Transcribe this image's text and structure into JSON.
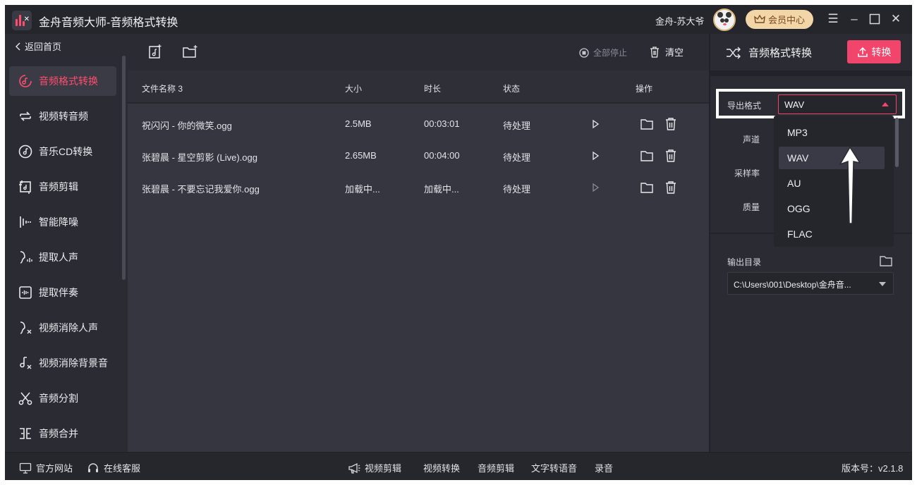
{
  "app": {
    "title": "金舟音频大师-音频格式转换",
    "user_name": "金舟-苏大爷",
    "vip_label": "会员中心"
  },
  "sidebar": {
    "back_label": "返回首页",
    "items": [
      {
        "label": "音频格式转换",
        "icon": "format-convert-icon",
        "active": true
      },
      {
        "label": "视频转音频",
        "icon": "video-to-audio-icon"
      },
      {
        "label": "音乐CD转换",
        "icon": "cd-icon"
      },
      {
        "label": "音频剪辑",
        "icon": "audio-cut-icon"
      },
      {
        "label": "智能降噪",
        "icon": "denoise-icon"
      },
      {
        "label": "提取人声",
        "icon": "voice-extract-icon"
      },
      {
        "label": "提取伴奏",
        "icon": "accompaniment-icon"
      },
      {
        "label": "视频消除人声",
        "icon": "video-remove-voice-icon"
      },
      {
        "label": "视频消除背景音",
        "icon": "video-remove-bgm-icon"
      },
      {
        "label": "音频分割",
        "icon": "scissors-icon"
      },
      {
        "label": "音频合并",
        "icon": "merge-icon"
      }
    ]
  },
  "toolbar": {
    "stop_all_label": "全部停止",
    "clear_label": "清空"
  },
  "list": {
    "headers": {
      "name": "文件名称 3",
      "size": "大小",
      "duration": "时长",
      "status": "状态",
      "actions": "操作"
    },
    "rows": [
      {
        "name": "祝闪闪 - 你的微笑.ogg",
        "size": "2.5MB",
        "duration": "00:03:01",
        "status": "待处理"
      },
      {
        "name": "张碧晨 - 星空剪影 (Live).ogg",
        "size": "2.65MB",
        "duration": "00:04:00",
        "status": "待处理"
      },
      {
        "name": "张碧晨 - 不要忘记我爱你.ogg",
        "size": "加载中...",
        "duration": "加载中...",
        "status": "待处理"
      }
    ]
  },
  "panel": {
    "title": "音频格式转换",
    "convert_label": "转换",
    "format_label": "导出格式",
    "format_value": "WAV",
    "channel_label": "声道",
    "sample_rate_label": "采样率",
    "quality_label": "质量",
    "output_label": "输出目录",
    "output_path": "C:\\Users\\001\\Desktop\\金舟音...",
    "format_options": [
      "MP3",
      "WAV",
      "AU",
      "OGG",
      "FLAC"
    ],
    "selected_option": "WAV"
  },
  "bottom": {
    "website": "官方网站",
    "service": "在线客服",
    "links": [
      "视频剪辑",
      "视频转换",
      "音频剪辑",
      "文字转语音",
      "录音"
    ],
    "version": "版本号：v2.1.8"
  },
  "colors": {
    "accent": "#f2456b",
    "background": "#2b2b33",
    "list_bg": "#363640",
    "vip_bg": "#f3d6a8"
  }
}
